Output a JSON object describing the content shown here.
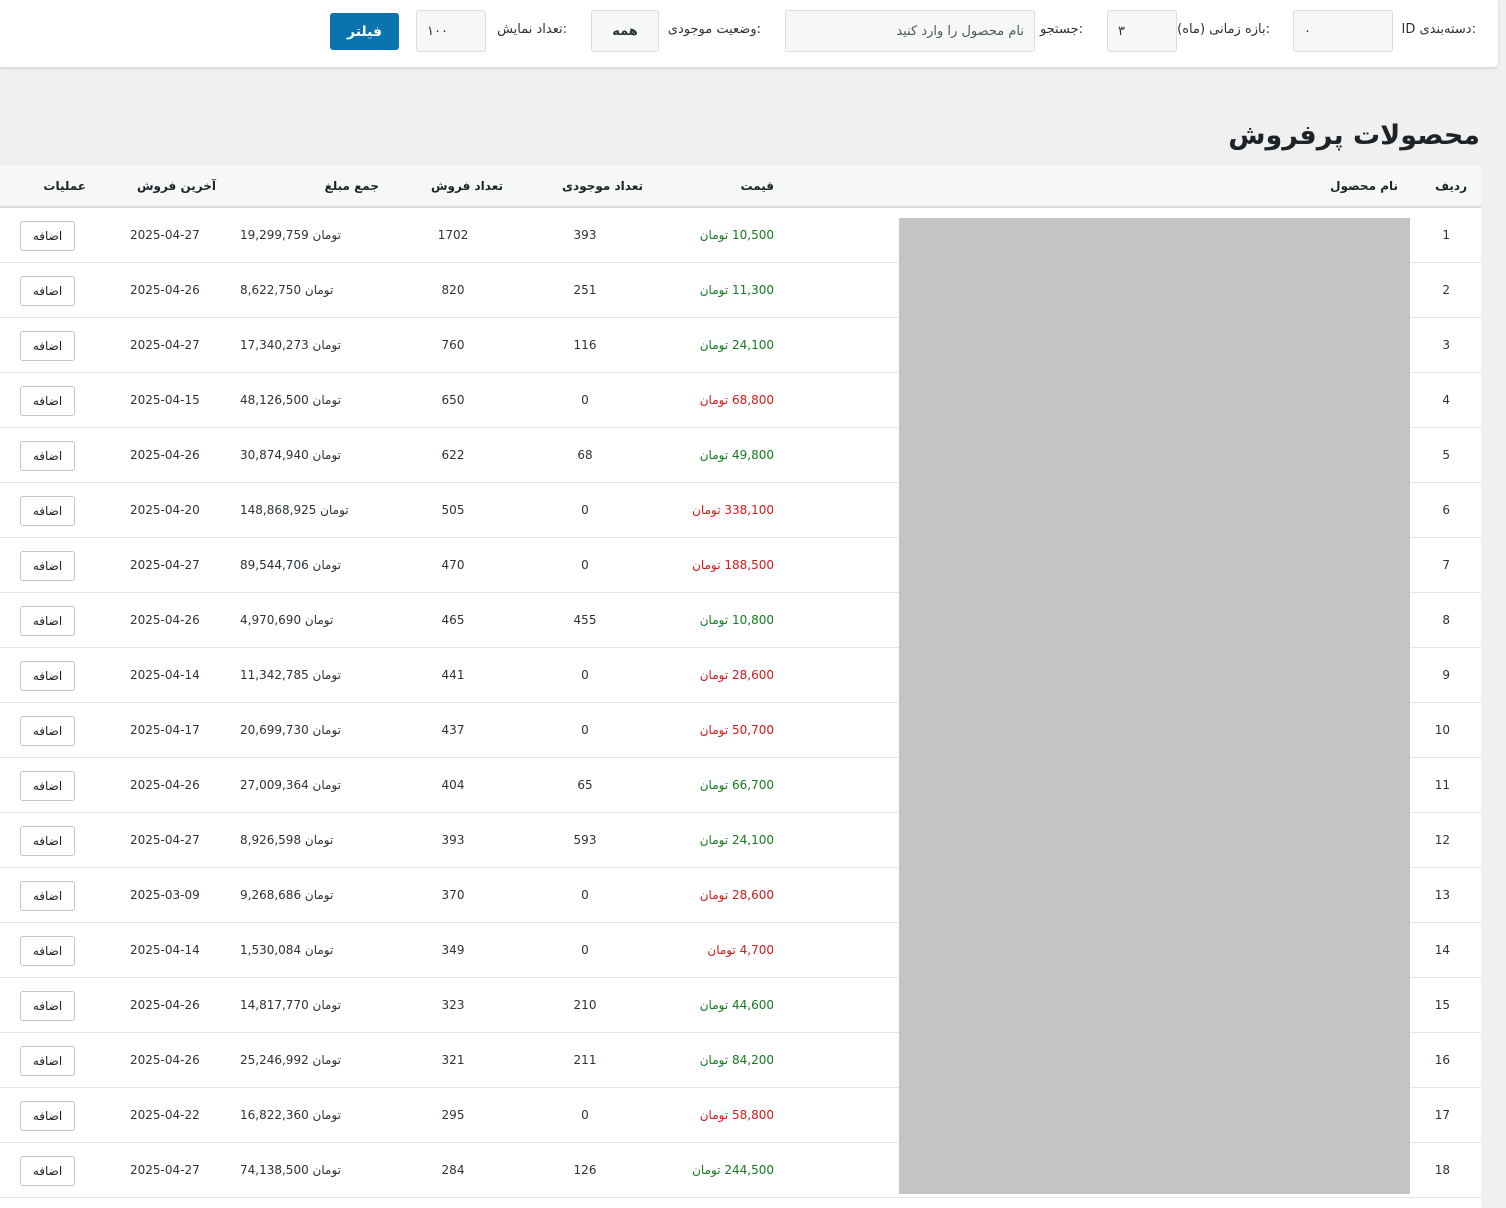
{
  "filters": {
    "category_label": "ID دسته‌بندی:",
    "category_value": "۰",
    "period_label": "بازه زمانی (ماه):",
    "period_value": "۳",
    "search_label": "جستجو:",
    "search_placeholder": "نام محصول را وارد کنید",
    "stock_label": "وضعیت موجودی:",
    "stock_value": "همه",
    "count_label": "تعداد نمایش:",
    "count_value": "۱۰۰",
    "filter_button": "فیلتر"
  },
  "page_title": "محصولات پرفروش",
  "table": {
    "headers": {
      "row": "ردیف",
      "name": "نام محصول",
      "price": "قیمت",
      "stock": "تعداد موجودی",
      "sales": "تعداد فروش",
      "total": "جمع مبلغ",
      "last_sale": "آخرین فروش",
      "actions": "عملیات"
    },
    "currency": "تومان",
    "add_label": "اضافه",
    "rows": [
      {
        "index": "1",
        "price": "10,500",
        "in_stock": true,
        "stock": "393",
        "sales": "1702",
        "total": "19,299,759",
        "last_sale": "2025-04-27"
      },
      {
        "index": "2",
        "price": "11,300",
        "in_stock": true,
        "stock": "251",
        "sales": "820",
        "total": "8,622,750",
        "last_sale": "2025-04-26"
      },
      {
        "index": "3",
        "price": "24,100",
        "in_stock": true,
        "stock": "116",
        "sales": "760",
        "total": "17,340,273",
        "last_sale": "2025-04-27"
      },
      {
        "index": "4",
        "price": "68,800",
        "in_stock": false,
        "stock": "0",
        "sales": "650",
        "total": "48,126,500",
        "last_sale": "2025-04-15"
      },
      {
        "index": "5",
        "price": "49,800",
        "in_stock": true,
        "stock": "68",
        "sales": "622",
        "total": "30,874,940",
        "last_sale": "2025-04-26"
      },
      {
        "index": "6",
        "price": "338,100",
        "in_stock": false,
        "stock": "0",
        "sales": "505",
        "total": "148,868,925",
        "last_sale": "2025-04-20"
      },
      {
        "index": "7",
        "price": "188,500",
        "in_stock": false,
        "stock": "0",
        "sales": "470",
        "total": "89,544,706",
        "last_sale": "2025-04-27"
      },
      {
        "index": "8",
        "price": "10,800",
        "in_stock": true,
        "stock": "455",
        "sales": "465",
        "total": "4,970,690",
        "last_sale": "2025-04-26"
      },
      {
        "index": "9",
        "price": "28,600",
        "in_stock": false,
        "stock": "0",
        "sales": "441",
        "total": "11,342,785",
        "last_sale": "2025-04-14"
      },
      {
        "index": "10",
        "price": "50,700",
        "in_stock": false,
        "stock": "0",
        "sales": "437",
        "total": "20,699,730",
        "last_sale": "2025-04-17"
      },
      {
        "index": "11",
        "price": "66,700",
        "in_stock": true,
        "stock": "65",
        "sales": "404",
        "total": "27,009,364",
        "last_sale": "2025-04-26"
      },
      {
        "index": "12",
        "price": "24,100",
        "in_stock": true,
        "stock": "593",
        "sales": "393",
        "total": "8,926,598",
        "last_sale": "2025-04-27"
      },
      {
        "index": "13",
        "price": "28,600",
        "in_stock": false,
        "stock": "0",
        "sales": "370",
        "total": "9,268,686",
        "last_sale": "2025-03-09"
      },
      {
        "index": "14",
        "price": "4,700",
        "in_stock": false,
        "stock": "0",
        "sales": "349",
        "total": "1,530,084",
        "last_sale": "2025-04-14"
      },
      {
        "index": "15",
        "price": "44,600",
        "in_stock": true,
        "stock": "210",
        "sales": "323",
        "total": "14,817,770",
        "last_sale": "2025-04-26"
      },
      {
        "index": "16",
        "price": "84,200",
        "in_stock": true,
        "stock": "211",
        "sales": "321",
        "total": "25,246,992",
        "last_sale": "2025-04-26"
      },
      {
        "index": "17",
        "price": "58,800",
        "in_stock": false,
        "stock": "0",
        "sales": "295",
        "total": "16,822,360",
        "last_sale": "2025-04-22"
      },
      {
        "index": "18",
        "price": "244,500",
        "in_stock": true,
        "stock": "126",
        "sales": "284",
        "total": "74,138,500",
        "last_sale": "2025-04-27"
      }
    ]
  },
  "colors": {
    "button_primary": "#0a73b0",
    "price_in_stock": "#157b1e",
    "price_out_of_stock": "#d11a1a",
    "name_mask": "#c4c4c4"
  }
}
